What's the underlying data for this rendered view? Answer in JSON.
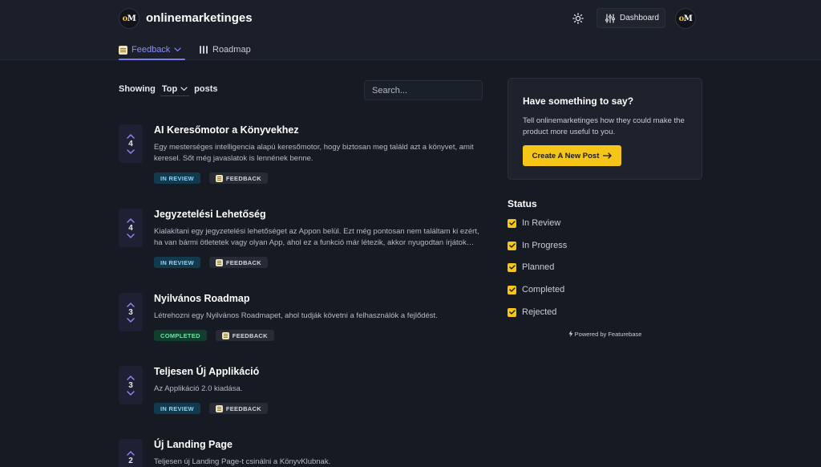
{
  "header": {
    "brand_name": "onlinemarketinges",
    "logo_text": "oM",
    "dashboard_label": "Dashboard",
    "tabs": [
      {
        "label": "Feedback",
        "icon": "memo-emoji-icon",
        "active": true
      },
      {
        "label": "Roadmap",
        "icon": "roadmap-icon",
        "active": false
      }
    ]
  },
  "sort": {
    "prefix": "Showing",
    "value": "Top",
    "suffix": "posts"
  },
  "search": {
    "placeholder": "Search..."
  },
  "posts": [
    {
      "votes": "4",
      "title": "AI Keresőmotor a Könyvekhez",
      "description": "Egy mesterséges intelligencia alapú keresőmotor, hogy biztosan meg találd azt a könyvet, amit keresel. Sőt még javaslatok is lennének benne.",
      "status_tag": "IN REVIEW",
      "category_tag": "FEEDBACK"
    },
    {
      "votes": "4",
      "title": "Jegyzetelési Lehetőség",
      "description": "Kialakítani egy jegyzetelési lehetőséget az Appon belül. Ezt még pontosan nem találtam ki ezért, ha van bármi ötletetek vagy olyan App, ahol ez a funkció már létezik, akkor nyugodtan írjátok meg.",
      "status_tag": "IN REVIEW",
      "category_tag": "FEEDBACK"
    },
    {
      "votes": "3",
      "title": "Nyilvános Roadmap",
      "description": "Létrehozni egy Nyilvános Roadmapet, ahol tudják követni a felhasználók a fejlődést.",
      "status_tag": "COMPLETED",
      "category_tag": "FEEDBACK"
    },
    {
      "votes": "3",
      "title": "Teljesen Új Applikáció",
      "description": "Az Applikáció 2.0 kiadása.",
      "status_tag": "IN REVIEW",
      "category_tag": "FEEDBACK"
    },
    {
      "votes": "2",
      "title": "Új Landing Page",
      "description": "Teljesen új Landing Page-t csinálni a KönyvKlubnak."
    }
  ],
  "cta": {
    "title": "Have something to say?",
    "text": "Tell onlinemarketinges how they could make the product more useful to you.",
    "button_label": "Create A New Post"
  },
  "status_filter": {
    "heading": "Status",
    "items": [
      {
        "label": "In Review",
        "checked": true
      },
      {
        "label": "In Progress",
        "checked": true
      },
      {
        "label": "Planned",
        "checked": true
      },
      {
        "label": "Completed",
        "checked": true
      },
      {
        "label": "Rejected",
        "checked": true
      }
    ]
  },
  "footer": {
    "powered_by": "Powered by Featurebase"
  },
  "colors": {
    "accent": "#8b8ff5",
    "cta_yellow": "#f5c518",
    "background": "#161a23",
    "in_review_tag": "#123a4f",
    "completed_tag": "#133d2d"
  }
}
